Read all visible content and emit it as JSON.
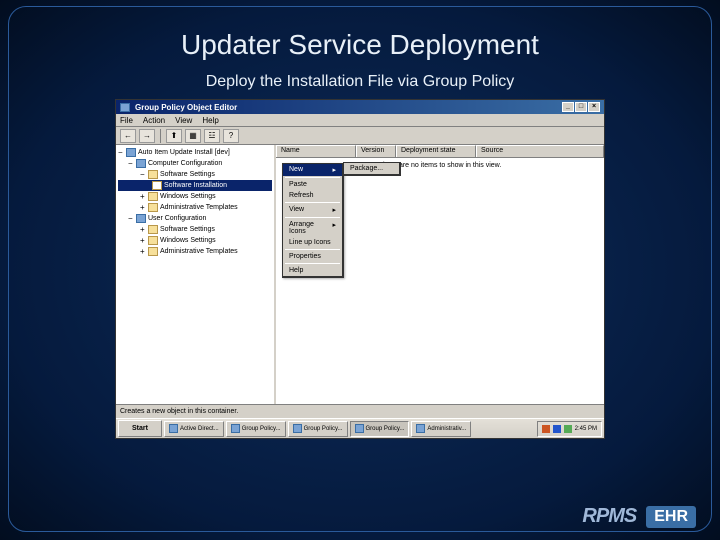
{
  "slide": {
    "title": "Updater Service Deployment",
    "subtitle": "Deploy the Installation File via Group Policy"
  },
  "window": {
    "title": "Group Policy Object Editor",
    "menus": [
      "File",
      "Action",
      "View",
      "Help"
    ],
    "toolbar_icons": [
      "back-arrow",
      "forward-arrow",
      "up-folder",
      "list-icon",
      "properties-icon",
      "help-icon"
    ]
  },
  "tree": {
    "root": "Auto Item Update Install [dev]",
    "sections": [
      {
        "name": "Computer Configuration",
        "items": [
          "Software Settings",
          "Software Installation",
          "Windows Settings",
          "Administrative Templates"
        ]
      },
      {
        "name": "User Configuration",
        "items": [
          "Software Settings",
          "Windows Settings",
          "Administrative Templates"
        ]
      }
    ],
    "selected": "Software Installation"
  },
  "list": {
    "columns": [
      "Name",
      "Version",
      "Deployment state",
      "Source"
    ],
    "empty": "There are no items to show in this view."
  },
  "context_menu": {
    "items": [
      {
        "label": "New",
        "submenu": true,
        "highlighted": true
      },
      {
        "label": "Paste"
      },
      {
        "label": "Refresh"
      },
      {
        "label": "View",
        "submenu": true
      },
      {
        "label": "Arrange Icons",
        "submenu": true
      },
      {
        "label": "Line up Icons"
      },
      {
        "label": "Properties"
      },
      {
        "label": "Help"
      }
    ],
    "submenu": [
      "Package..."
    ]
  },
  "statusbar": "Creates a new object in this container.",
  "taskbar": {
    "start": "Start",
    "buttons": [
      "Active Direct...",
      "Group Policy...",
      "Group Policy...",
      "Group Policy...",
      "Administrativ..."
    ],
    "active_index": 3,
    "tray_time": "2:45 PM"
  },
  "logos": {
    "rpms": "RPMS",
    "ehr": "EHR"
  }
}
